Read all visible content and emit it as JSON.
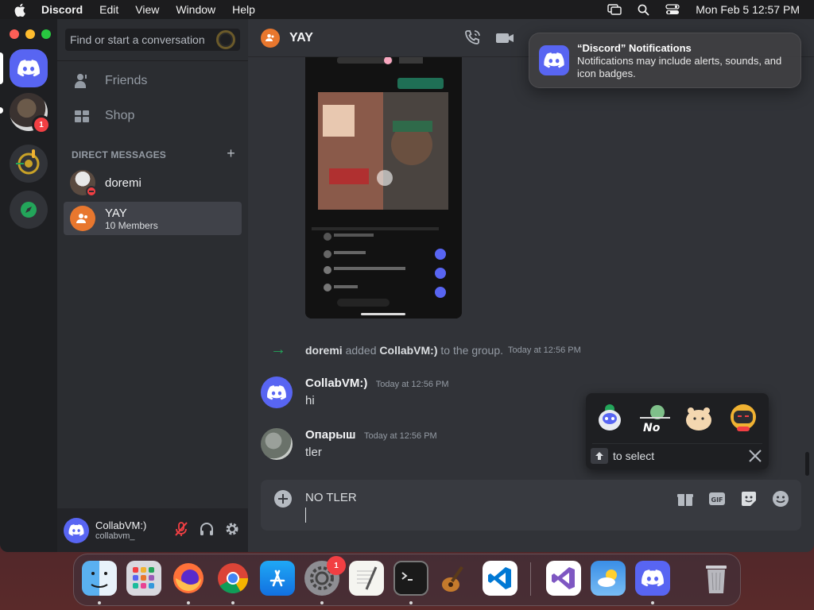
{
  "menubar": {
    "app": "Discord",
    "items": [
      "Edit",
      "View",
      "Window",
      "Help"
    ],
    "datetime": "Mon Feb 5  12:57 PM"
  },
  "servers": {
    "badge_count": "1"
  },
  "sidebar": {
    "search_placeholder": "Find or start a conversation",
    "nav": [
      {
        "label": "Friends",
        "icon": "friends-icon"
      },
      {
        "label": "Shop",
        "icon": "shop-icon"
      }
    ],
    "dm_header": "DIRECT MESSAGES",
    "dms": [
      {
        "name": "doremi",
        "sub": ""
      },
      {
        "name": "YAY",
        "sub": "10 Members"
      }
    ]
  },
  "user_panel": {
    "display_name": "CollabVM:)",
    "handle": "collabvm_"
  },
  "chat": {
    "title": "YAY",
    "system_message": {
      "actor": "doremi",
      "verb": " added ",
      "target": "CollabVM:)",
      "suffix": " to the group.",
      "timestamp": "Today at 12:56 PM"
    },
    "messages": [
      {
        "author": "CollabVM:)",
        "timestamp": "Today at 12:56 PM",
        "text": "hi"
      },
      {
        "author": "Опарыш",
        "timestamp": "Today at 12:56 PM",
        "text": "tler"
      }
    ]
  },
  "sticker_picker": {
    "hint": "to select"
  },
  "composer": {
    "value": "NO TLER"
  },
  "notification": {
    "title": "“Discord” Notifications",
    "body": "Notifications may include alerts, sounds, and icon badges."
  },
  "dock": {
    "settings_badge": "1",
    "apps": [
      "Finder",
      "Launchpad",
      "Firefox",
      "Chrome",
      "App Store",
      "System Settings",
      "TextEdit",
      "Terminal",
      "GarageBand",
      "VS Code",
      "Visual Studio",
      "Weather",
      "Discord",
      "Trash"
    ]
  },
  "colors": {
    "blurple": "#5865f2",
    "online_green": "#23a55a",
    "dnd_red": "#f23f43",
    "group_orange": "#e8772e"
  }
}
